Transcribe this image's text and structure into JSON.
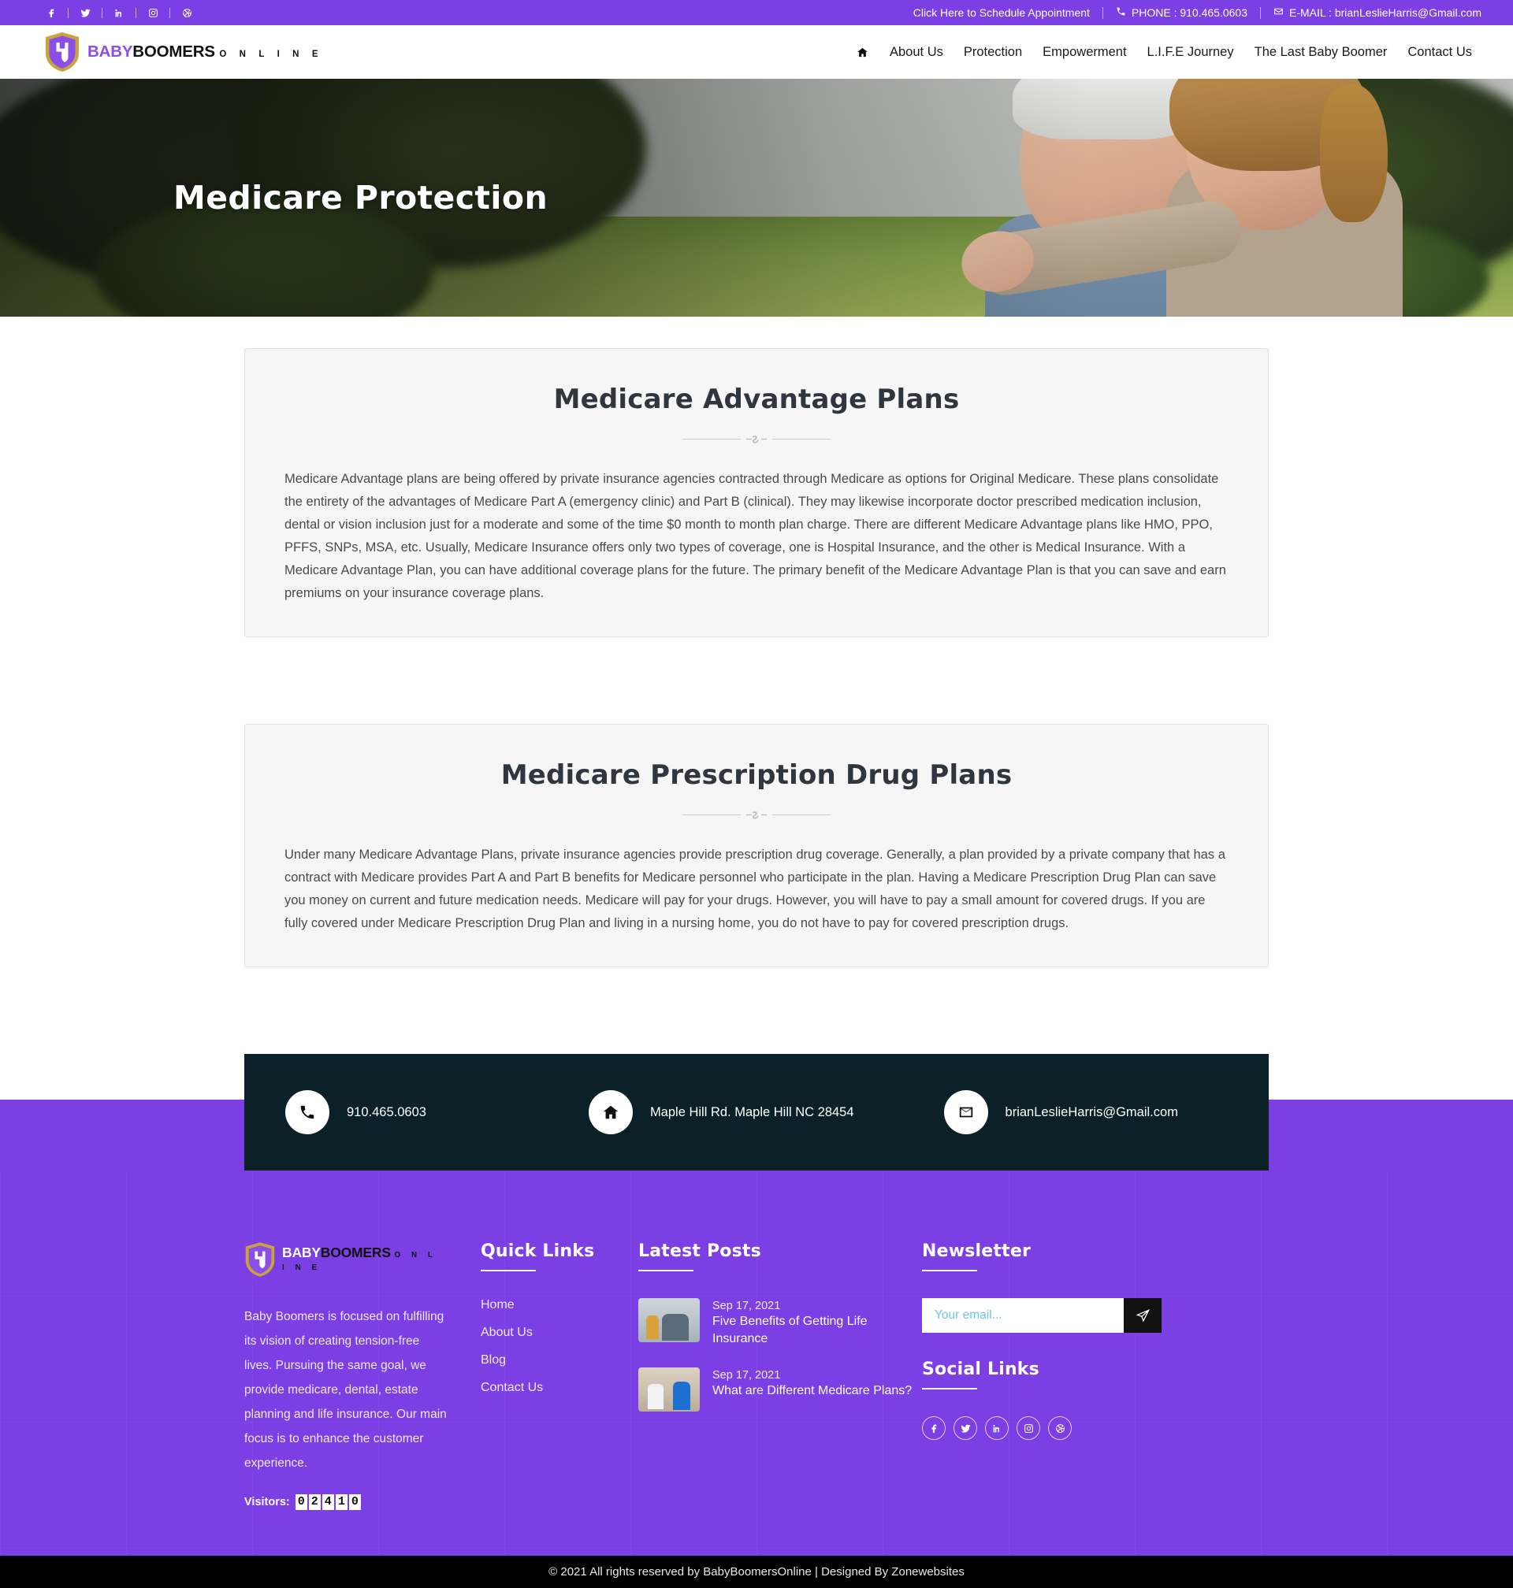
{
  "topbar": {
    "social": [
      {
        "name": "facebook-icon",
        "label": "Facebook"
      },
      {
        "name": "twitter-icon",
        "label": "Twitter"
      },
      {
        "name": "linkedin-icon",
        "label": "LinkedIn"
      },
      {
        "name": "instagram-icon",
        "label": "Instagram"
      },
      {
        "name": "dribbble-icon",
        "label": "Dribbble"
      }
    ],
    "appointment": "Click Here to Schedule Appointment",
    "phone": "PHONE : 910.465.0603",
    "email": "E-MAIL : brianLeslieHarris@Gmail.com"
  },
  "logo": {
    "line1_a": "BABY",
    "line1_b": "BOOMERS",
    "line2": "O N L I N E"
  },
  "nav": {
    "home_icon": "home-icon",
    "items": [
      {
        "label": "About Us"
      },
      {
        "label": "Protection"
      },
      {
        "label": "Empowerment"
      },
      {
        "label": "L.I.F.E Journey"
      },
      {
        "label": "The Last Baby Boomer"
      },
      {
        "label": "Contact Us"
      }
    ]
  },
  "hero": {
    "title": "Medicare Protection"
  },
  "cards": [
    {
      "title": "Medicare Advantage Plans",
      "body": "Medicare Advantage plans are being offered by private insurance agencies contracted through Medicare as options for Original Medicare. These plans consolidate the entirety of the advantages of Medicare Part A (emergency clinic) and Part B (clinical). They may likewise incorporate doctor prescribed medication inclusion, dental or vision inclusion just for a moderate and some of the time $0 month to month plan charge. There are different Medicare Advantage plans like HMO, PPO, PFFS, SNPs, MSA, etc. Usually, Medicare Insurance offers only two types of coverage, one is Hospital Insurance, and the other is Medical Insurance. With a Medicare Advantage Plan, you can have additional coverage plans for the future. The primary benefit of the Medicare Advantage Plan is that you can save and earn premiums on your insurance coverage plans."
    },
    {
      "title": "Medicare Prescription Drug Plans",
      "body": "Under many Medicare Advantage Plans, private insurance agencies provide prescription drug coverage. Generally, a plan provided by a private company that has a contract with Medicare provides Part A and Part B benefits for Medicare personnel who participate in the plan. Having a Medicare Prescription Drug Plan can save you money on current and future medication needs. Medicare will pay for your drugs. However, you will have to pay a small amount for covered drugs. If you are fully covered under Medicare Prescription Drug Plan and living in a nursing home, you do not have to pay for covered prescription drugs."
    }
  ],
  "contact_strip": {
    "phone": "910.465.0603",
    "address": "Maple Hill Rd. Maple Hill NC 28454",
    "email": "brianLeslieHarris@Gmail.com"
  },
  "footer": {
    "about_text": "Baby Boomers is focused on fulfilling its vision of creating tension-free lives. Pursuing the same goal, we provide medicare, dental, estate planning and life insurance. Our main focus is to enhance the customer experience.",
    "visitors_label": "Visitors:",
    "visitors_digits": [
      "0",
      "2",
      "4",
      "1",
      "0"
    ],
    "quick_links_title": "Quick Links",
    "quick_links": [
      {
        "label": "Home"
      },
      {
        "label": "About Us"
      },
      {
        "label": "Blog"
      },
      {
        "label": "Contact Us"
      }
    ],
    "latest_posts_title": "Latest Posts",
    "posts": [
      {
        "date": "Sep 17, 2021",
        "title": "Five Benefits of Getting Life Insurance"
      },
      {
        "date": "Sep 17, 2021",
        "title": "What are Different Medicare Plans?"
      }
    ],
    "newsletter_title": "Newsletter",
    "newsletter_placeholder": "Your email...",
    "newsletter_value": "",
    "social_title": "Social Links",
    "social": [
      {
        "name": "facebook-icon"
      },
      {
        "name": "twitter-icon"
      },
      {
        "name": "linkedin-icon"
      },
      {
        "name": "instagram-icon"
      },
      {
        "name": "dribbble-icon"
      }
    ]
  },
  "bottom": {
    "copyright": "© 2021 All rights reserved by BabyBoomersOnline | Designed By Zonewebsites"
  },
  "colors": {
    "brand_purple": "#7B3FE4",
    "dark_navy": "#0b2027",
    "gold": "#c9a33b",
    "card_bg": "#f6f6f6"
  }
}
